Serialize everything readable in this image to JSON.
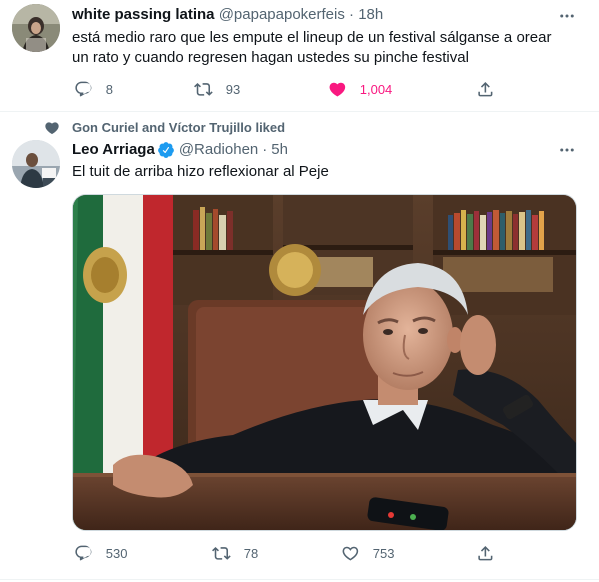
{
  "tweet1": {
    "display_name": "white passing latina",
    "handle": "@papapapokerfeis",
    "separator": "·",
    "time": "18h",
    "text": "está medio raro que les empute el lineup de un festival sálganse a orear un rato y cuando regresen hagan ustedes su pinche festival",
    "reply_count": "8",
    "retweet_count": "93",
    "like_count": "1,004",
    "liked": true,
    "like_color": "#f91880"
  },
  "tweet2": {
    "social_context": "Gon Curiel and Víctor Trujillo liked",
    "display_name": "Leo Arriaga",
    "handle": "@Radiohen",
    "separator": "·",
    "time": "5h",
    "verified": true,
    "verified_color": "#1d9bf0",
    "text": "El tuit de arriba hizo reflexionar al Peje",
    "reply_count": "530",
    "retweet_count": "78",
    "like_count": "753"
  },
  "colors": {
    "text_primary": "#0f1419",
    "text_secondary": "#536471",
    "divider": "#eff3f4"
  },
  "icons": {
    "reply": "reply-icon",
    "retweet": "retweet-icon",
    "like": "heart-icon",
    "share": "share-icon",
    "more": "more-dots-icon",
    "verified": "verified-badge-icon"
  }
}
